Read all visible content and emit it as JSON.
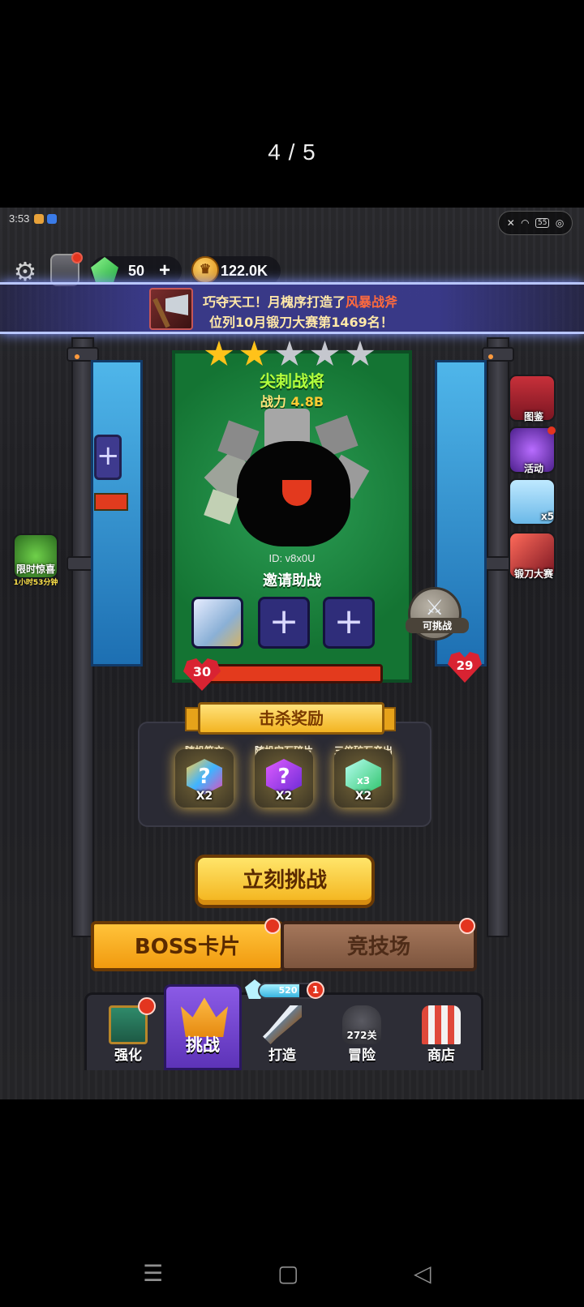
{
  "viewer": {
    "page_counter": "4 / 5"
  },
  "status_bar": {
    "time": "3:53",
    "battery": "55"
  },
  "resources": {
    "gems": "50",
    "coins": "122.0K"
  },
  "news": {
    "line1_prefix": "巧夺天工！月槐序打造了",
    "line1_item": "风暴战斧",
    "line2": "位列10月锻刀大赛第1469名！"
  },
  "boss_card": {
    "stars_filled": 2,
    "stars_total": 5,
    "name": "尖刺战将",
    "power_label": "战力",
    "power_value": "4.8B",
    "id_text": "ID: v8x0U",
    "invite_label": "邀请助战",
    "hp_level": "30"
  },
  "neighbor_card": {
    "hp_level": "29",
    "challengeable_label": "可挑战"
  },
  "side_menu": {
    "codex": "图鉴",
    "events": "活动",
    "ice_bear_count": "x5",
    "forge_contest": "锻刀大赛"
  },
  "limited_offer": {
    "label": "限时惊喜",
    "timer": "1小时53分钟"
  },
  "rewards": {
    "title": "击杀奖励",
    "items": [
      {
        "label": "随机符文",
        "mult": "X2"
      },
      {
        "label": "随机宝石碎片",
        "mult": "X2"
      },
      {
        "label": "三倍矿石产出",
        "mult": "X2",
        "badge": "x3"
      }
    ]
  },
  "actions": {
    "challenge_now": "立刻挑战"
  },
  "modes": {
    "boss_card": "BOSS卡片",
    "arena": "竞技场"
  },
  "bottom_nav": {
    "strengthen": "强化",
    "challenge": "挑战",
    "forge": "打造",
    "forge_xp": "520",
    "forge_badge": "1",
    "adventure": "冒险",
    "adventure_level": "272关",
    "shop": "商店"
  }
}
